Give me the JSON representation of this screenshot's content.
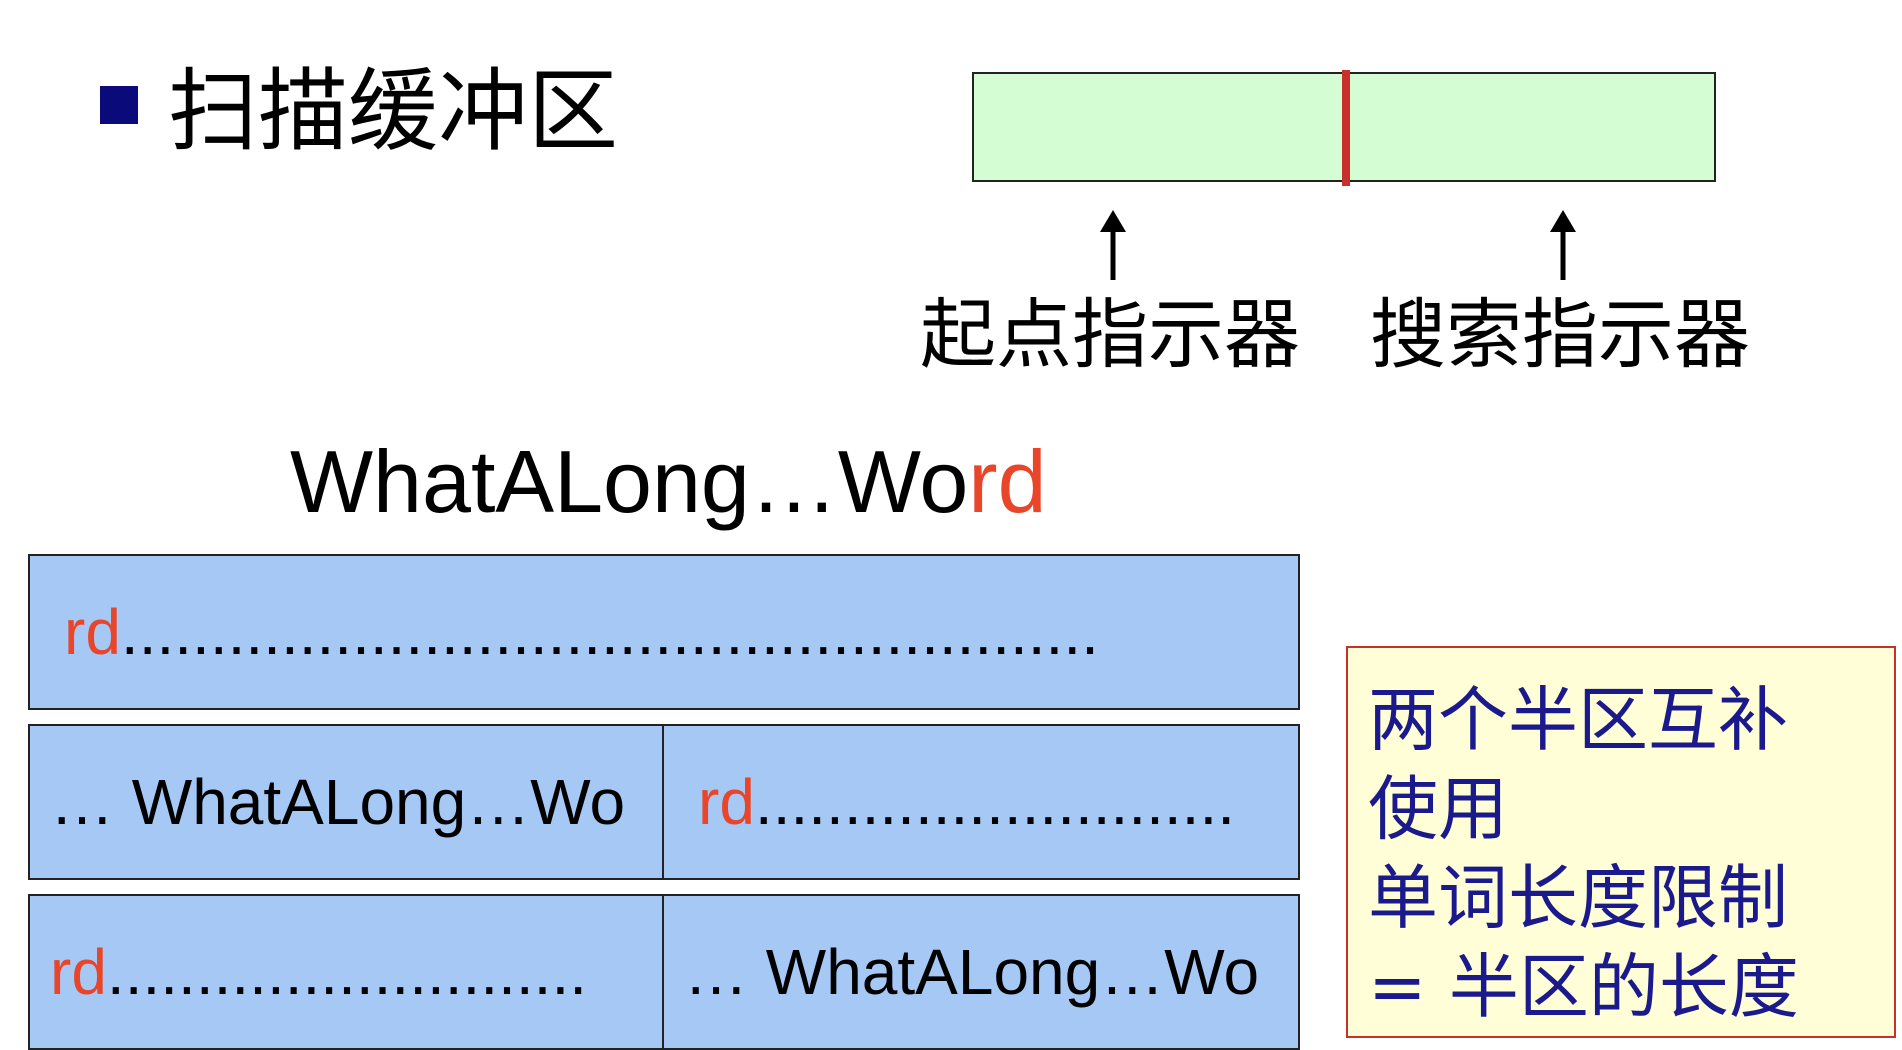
{
  "title": "扫描缓冲区",
  "pointers": {
    "start_label": "起点指示器",
    "search_label": "搜索指示器"
  },
  "word": {
    "black_part": "WhatALong…Wo",
    "red_part": "rd"
  },
  "rows": [
    {
      "cells": [
        {
          "red": "rd",
          "text": "......................................................."
        }
      ]
    },
    {
      "cells": [
        {
          "red": "",
          "text": "… WhatALong…Wo"
        },
        {
          "red": "rd",
          "text": "..........................."
        }
      ]
    },
    {
      "cells": [
        {
          "red": "rd",
          "text": "..........................."
        },
        {
          "red": "",
          "text": "… WhatALong…Wo"
        }
      ]
    }
  ],
  "note": {
    "lines": [
      "两个半区互补",
      "使用",
      "单词长度限制",
      "= 半区的长度"
    ]
  },
  "colors": {
    "buffer_fill": "#d4fdd4",
    "divider": "#c8312b",
    "row_fill": "#a6c8f5",
    "highlight_text": "#e8452a",
    "note_fill": "#fffed6",
    "note_text": "#1a1a8c",
    "bullet": "#0a0a7a"
  }
}
